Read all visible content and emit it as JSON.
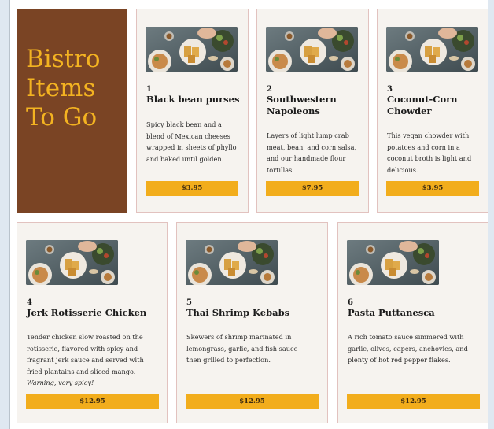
{
  "brand": {
    "title": "Bistro Items To Go"
  },
  "image_icon": "plate-food-photo",
  "colors": {
    "brand_bg": "#7a4424",
    "brand_text": "#f3b321",
    "price_bg": "#f2ad1c",
    "card_bg": "#f6f3ef"
  },
  "items": [
    {
      "number": "1",
      "title": "Black bean purses",
      "description": "Spicy black bean and a blend of Mexican cheeses wrapped in sheets of phyllo and baked until golden.",
      "warning": "",
      "price": "$3.95"
    },
    {
      "number": "2",
      "title": "Southwestern Napoleons",
      "description": "Layers of light lump crab meat, bean, and corn salsa, and our handmade flour tortillas.",
      "warning": "",
      "price": "$7.95"
    },
    {
      "number": "3",
      "title": "Coconut-Corn Chowder",
      "description": "This vegan chowder with potatoes and corn in a coconut broth is light and delicious.",
      "warning": "",
      "price": "$3.95"
    },
    {
      "number": "4",
      "title": "Jerk Rotisserie Chicken",
      "description": "Tender chicken slow roasted on the rotisserie, flavored with spicy and fragrant jerk sauce and served with fried plantains and sliced mango.",
      "warning": "Warning, very spicy!",
      "price": "$12.95"
    },
    {
      "number": "5",
      "title": "Thai Shrimp Kebabs",
      "description": "Skewers of shrimp marinated in lemongrass, garlic, and fish sauce then grilled to perfection.",
      "warning": "",
      "price": "$12.95"
    },
    {
      "number": "6",
      "title": "Pasta Puttanesca",
      "description": "A rich tomato sauce simmered with garlic, olives, capers, anchovies, and plenty of hot red pepper flakes.",
      "warning": "",
      "price": "$12.95"
    }
  ]
}
